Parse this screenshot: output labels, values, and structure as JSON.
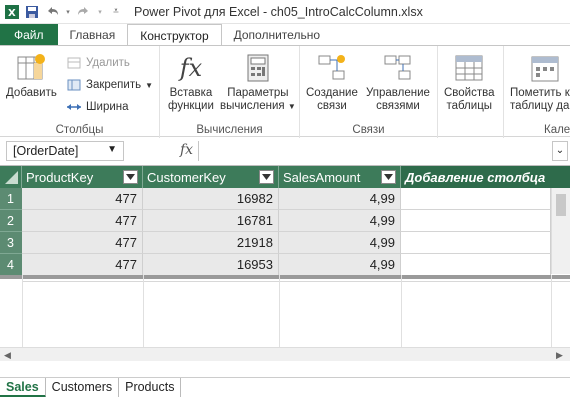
{
  "window": {
    "title": "Power Pivot для Excel - ch05_IntroCalcColumn.xlsx",
    "accent_color": "#217346",
    "qat_icons": [
      "excel-icon",
      "save-icon",
      "undo-icon",
      "redo-icon",
      "customize-qat-icon"
    ]
  },
  "tabs": [
    {
      "label": "Файл"
    },
    {
      "label": "Главная"
    },
    {
      "label": "Конструктор"
    },
    {
      "label": "Дополнительно"
    }
  ],
  "active_tab": "Конструктор",
  "ribbon": {
    "groups": {
      "columns": {
        "label": "Столбцы",
        "add": "Добавить",
        "delete": "Удалить",
        "freeze": "Закрепить",
        "width": "Ширина"
      },
      "calculations": {
        "label": "Вычисления",
        "insert_function_1": "Вставка",
        "insert_function_2": "функции",
        "calc_options_1": "Параметры",
        "calc_options_2": "вычисления"
      },
      "relationships": {
        "label": "Связи",
        "create_1": "Создание",
        "create_2": "связи",
        "manage_1": "Управление",
        "manage_2": "связями"
      },
      "table_props": {
        "label_1": "Свойства",
        "label_2": "таблицы"
      },
      "calendars": {
        "label": "Кален",
        "mark_1": "Пометить к",
        "mark_2": "таблицу да"
      }
    }
  },
  "formula_bar": {
    "name_box": "[OrderDate]",
    "fx": "fx",
    "formula": ""
  },
  "grid": {
    "columns": [
      "ProductKey",
      "CustomerKey",
      "SalesAmount",
      "Добавление столбца"
    ],
    "rows": [
      {
        "num": "1",
        "cells": [
          "477",
          "16982",
          "4,99"
        ]
      },
      {
        "num": "2",
        "cells": [
          "477",
          "16781",
          "4,99"
        ]
      },
      {
        "num": "3",
        "cells": [
          "477",
          "21918",
          "4,99"
        ]
      },
      {
        "num": "4",
        "cells": [
          "477",
          "16953",
          "4,99"
        ]
      }
    ],
    "header_color": "#3d7b5a"
  },
  "sheet_tabs": [
    {
      "label": "Sales",
      "active": true
    },
    {
      "label": "Customers",
      "active": false
    },
    {
      "label": "Products",
      "active": false
    }
  ]
}
